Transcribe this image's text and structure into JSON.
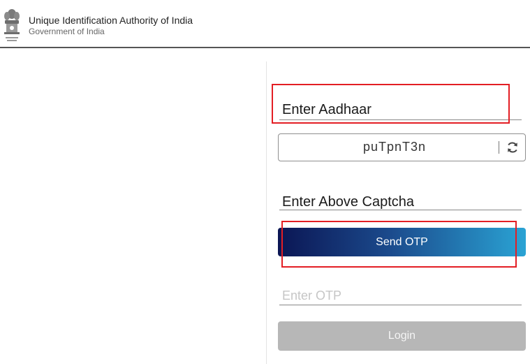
{
  "header": {
    "org_name": "Unique Identification Authority of India",
    "org_sub": "Government of India",
    "emblem_icon": "national-emblem-icon"
  },
  "form": {
    "aadhaar_label": "Enter Aadhaar",
    "captcha_text": "puTpnT3n",
    "refresh_icon": "refresh-icon",
    "captcha_label": "Enter Above Captcha",
    "send_otp_label": "Send OTP",
    "otp_placeholder": "Enter OTP",
    "login_label": "Login"
  },
  "colors": {
    "highlight": "#e31e24",
    "send_otp_gradient_start": "#0b1654",
    "send_otp_gradient_end": "#2aa3d4",
    "login_disabled": "#b7b7b7"
  }
}
